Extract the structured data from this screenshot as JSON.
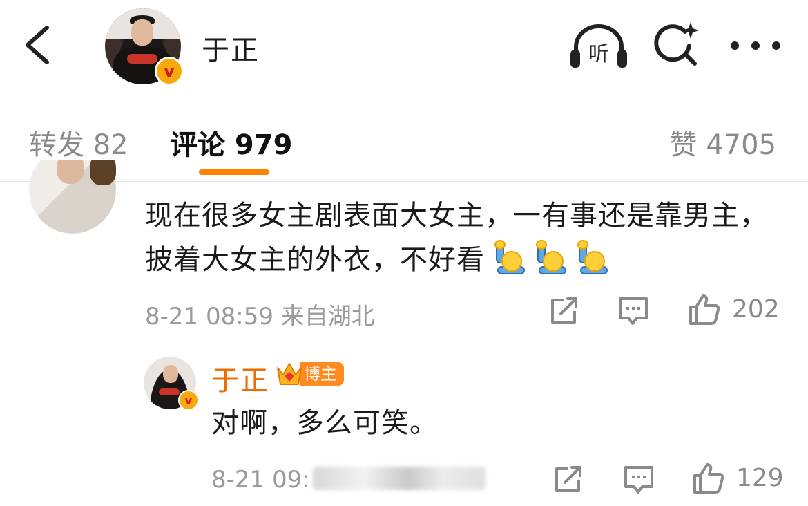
{
  "header": {
    "title": "于正",
    "listen_label": "听",
    "verified_mark": "v",
    "icons": [
      "chevron-left-icon",
      "headphones-icon",
      "search-sparkle-icon",
      "more-icon"
    ]
  },
  "tabs": {
    "repost": "转发 82",
    "comment": "评论 979",
    "like": "赞 4705",
    "active_color": "#ff8200"
  },
  "comments": [
    {
      "text": "现在很多女主剧表面大女主，一有事还是靠男主，披着大女主的外衣，不好看",
      "emoji_count": 3,
      "emoji": "raising-hand-emoji",
      "time": "8-21 08:59",
      "location": "来自湖北",
      "likes": "202"
    },
    {
      "author": "于正",
      "badge": "博主",
      "verified_mark": "v",
      "text": "对啊，多么可笑。",
      "time": "8-21 09:",
      "likes": "129",
      "author_color": "#f06c00"
    }
  ]
}
